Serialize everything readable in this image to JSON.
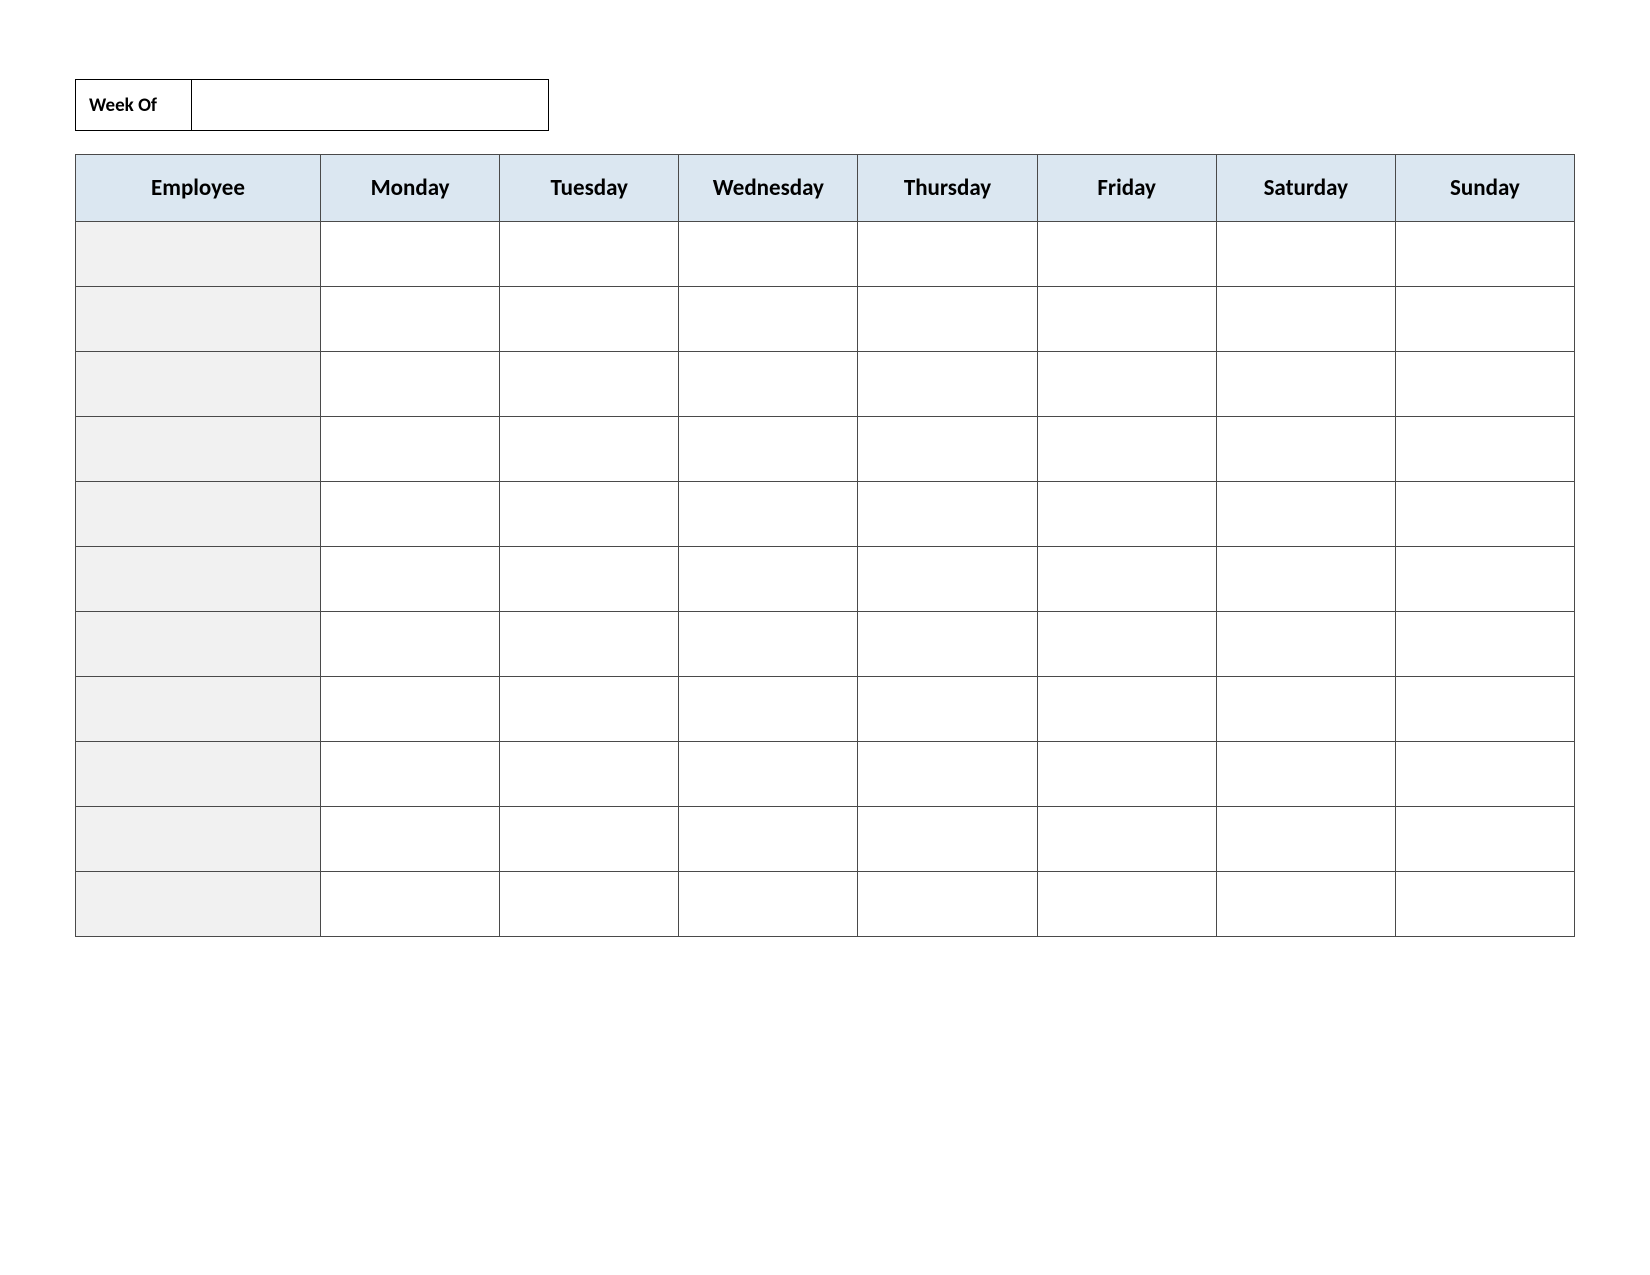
{
  "weekOf": {
    "label": "Week Of",
    "value": ""
  },
  "columns": [
    "Employee",
    "Monday",
    "Tuesday",
    "Wednesday",
    "Thursday",
    "Friday",
    "Saturday",
    "Sunday"
  ],
  "rows": [
    {
      "employee": "",
      "cells": [
        "",
        "",
        "",
        "",
        "",
        "",
        ""
      ]
    },
    {
      "employee": "",
      "cells": [
        "",
        "",
        "",
        "",
        "",
        "",
        ""
      ]
    },
    {
      "employee": "",
      "cells": [
        "",
        "",
        "",
        "",
        "",
        "",
        ""
      ]
    },
    {
      "employee": "",
      "cells": [
        "",
        "",
        "",
        "",
        "",
        "",
        ""
      ]
    },
    {
      "employee": "",
      "cells": [
        "",
        "",
        "",
        "",
        "",
        "",
        ""
      ]
    },
    {
      "employee": "",
      "cells": [
        "",
        "",
        "",
        "",
        "",
        "",
        ""
      ]
    },
    {
      "employee": "",
      "cells": [
        "",
        "",
        "",
        "",
        "",
        "",
        ""
      ]
    },
    {
      "employee": "",
      "cells": [
        "",
        "",
        "",
        "",
        "",
        "",
        ""
      ]
    },
    {
      "employee": "",
      "cells": [
        "",
        "",
        "",
        "",
        "",
        "",
        ""
      ]
    },
    {
      "employee": "",
      "cells": [
        "",
        "",
        "",
        "",
        "",
        "",
        ""
      ]
    },
    {
      "employee": "",
      "cells": [
        "",
        "",
        "",
        "",
        "",
        "",
        ""
      ]
    }
  ]
}
